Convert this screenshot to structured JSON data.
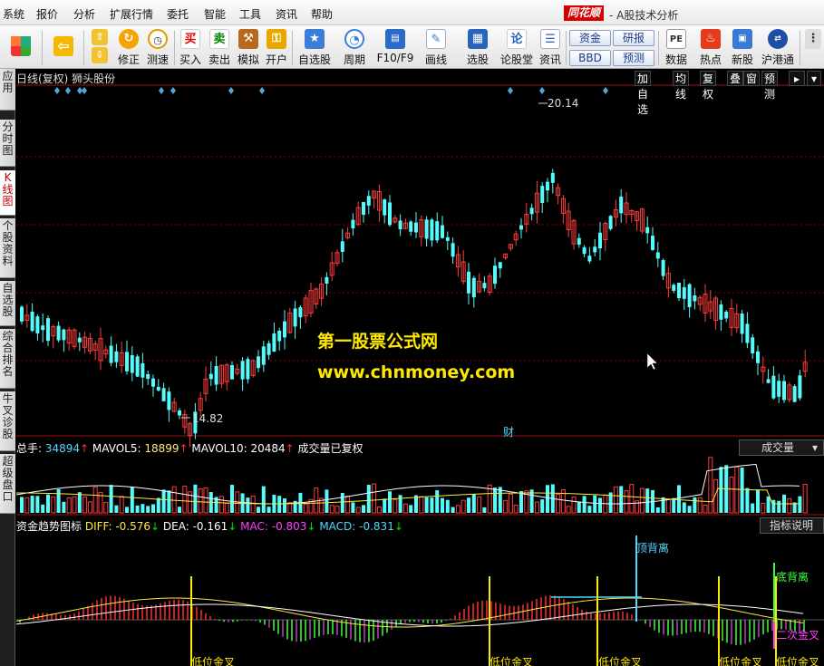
{
  "menu": [
    "系统",
    "报价",
    "分析",
    "扩展行情",
    "委托",
    "智能",
    "工具",
    "资讯",
    "帮助"
  ],
  "brand": {
    "logo": "同花顺",
    "title": "- A股技术分析"
  },
  "toolbar": {
    "items": [
      {
        "label": "",
        "icon": "windows-logo-icon"
      },
      {
        "label": "",
        "icon": "back-arrow-icon"
      },
      {
        "label": "修正",
        "icon": "fix-icon"
      },
      {
        "label": "测速",
        "icon": "clock-icon"
      },
      {
        "label": "买入",
        "icon": "buy-icon",
        "glyph": "买"
      },
      {
        "label": "卖出",
        "icon": "sell-icon",
        "glyph": "卖"
      },
      {
        "label": "模拟",
        "icon": "gavel-icon"
      },
      {
        "label": "开户",
        "icon": "lock-icon"
      },
      {
        "label": "自选股",
        "icon": "star-icon"
      },
      {
        "label": "周期",
        "icon": "period-icon"
      },
      {
        "label": "F10/F9",
        "icon": "f10-icon"
      },
      {
        "label": "画线",
        "icon": "pen-icon"
      },
      {
        "label": "选股",
        "icon": "picker-icon"
      },
      {
        "label": "论股堂",
        "icon": "lun-icon",
        "glyph": "论"
      },
      {
        "label": "资讯",
        "icon": "news-icon"
      },
      {
        "label": "数据",
        "icon": "pe-icon",
        "glyph": "PE"
      },
      {
        "label": "热点",
        "icon": "hot-icon"
      },
      {
        "label": "新股",
        "icon": "ipo-icon"
      },
      {
        "label": "沪港通",
        "icon": "hk-icon"
      }
    ],
    "box_buttons": [
      "资金",
      "BBD",
      "研报",
      "预测"
    ]
  },
  "sidebar": {
    "tabs": [
      "应用",
      "分时图",
      "K线图",
      "个股资料",
      "自选股",
      "综合排名",
      "牛叉诊股",
      "超级盘口"
    ],
    "active": 2
  },
  "chart": {
    "header": "日线(复权) 狮头股份",
    "top_buttons": [
      "加自选",
      "均线",
      "复权",
      "叠",
      "窗",
      "预测"
    ],
    "high_label": "20.14",
    "low_label": "14.82",
    "cai_marker": "财"
  },
  "volume": {
    "items": [
      {
        "text": "总手: ",
        "color": "#ffffff"
      },
      {
        "text": "34894",
        "color": "#4fd8ff"
      },
      {
        "text": "↑",
        "color": "#ff3030"
      },
      {
        "text": " MAVOL5: ",
        "color": "#ffffff"
      },
      {
        "text": "18899",
        "color": "#ffeb7a"
      },
      {
        "text": "↑",
        "color": "#ff3030"
      },
      {
        "text": " MAVOL10: ",
        "color": "#ffffff"
      },
      {
        "text": "20484",
        "color": "#ffffff"
      },
      {
        "text": "↑",
        "color": "#ff3030"
      },
      {
        "text": " 成交量已复权",
        "color": "#ffffff"
      }
    ],
    "dropdown": "成交量"
  },
  "indicator": {
    "items": [
      {
        "text": "资金趋势图标 ",
        "color": "#ffffff"
      },
      {
        "text": "DIFF: -0.576",
        "color": "#ffeb3b"
      },
      {
        "text": "↓",
        "color": "#00e000"
      },
      {
        "text": " DEA: -0.161",
        "color": "#ffffff"
      },
      {
        "text": "↓",
        "color": "#00e000"
      },
      {
        "text": " MAC: -0.803",
        "color": "#ff40ff"
      },
      {
        "text": "↓",
        "color": "#00e000"
      },
      {
        "text": " MACD: -0.831",
        "color": "#4fd8ff"
      },
      {
        "text": "↓",
        "color": "#00e000"
      }
    ],
    "button": "指标说明",
    "signals": {
      "top_div": "顶背离",
      "bottom_div": "底背离",
      "second_cross": "二次金叉",
      "low_cross": "低位金叉"
    }
  },
  "watermark": {
    "line1": "第一股票公式网",
    "line2": "www.chnmoney.com"
  },
  "colors": {
    "up": "#ff3c3c",
    "down": "#54fcfc",
    "ma5": "#ffffff",
    "ma10": "#ffeb3b",
    "grid": "#8b0000"
  }
}
